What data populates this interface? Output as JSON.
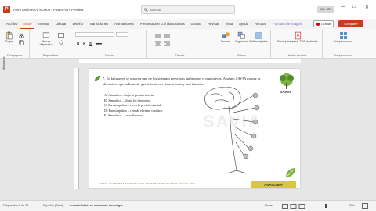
{
  "titlebar": {
    "app_logo": "P",
    "doc_title": "ANATOMÍA REV SEM09 - PowerPoint Preview",
    "search_placeholder": "Buscar",
    "account": "INC. SRL",
    "controls": [
      "—",
      "□",
      "✕"
    ]
  },
  "tabs": [
    {
      "label": "Archivo"
    },
    {
      "label": "Inicio",
      "active": true
    },
    {
      "label": "Insertar"
    },
    {
      "label": "Dibujar"
    },
    {
      "label": "Diseño"
    },
    {
      "label": "Transiciones"
    },
    {
      "label": "Animaciones"
    },
    {
      "label": "Presentación con diapositivas"
    },
    {
      "label": "Grabar"
    },
    {
      "label": "Revisar"
    },
    {
      "label": "Vista"
    },
    {
      "label": "Ayuda"
    },
    {
      "label": "Acrobat"
    },
    {
      "label": "Formato de imagen",
      "context": true
    }
  ],
  "actions": {
    "record": "Grabar",
    "share": "Compartir"
  },
  "ribbon": {
    "groups": [
      "Portapapeles",
      "Diapositivas",
      "Fuente",
      "Párrafo",
      "Dibujo",
      "Adobe Acrobat",
      "Complementos"
    ],
    "buttons": {
      "paste": "Pegar",
      "new_slide": "Nueva diapositiva",
      "shapes": "Formas",
      "arrange": "Organizar",
      "quick_styles": "Estilos rápidos",
      "create_pdf": "Crear y compartir PDF de Adobe",
      "addins": "Complementos"
    },
    "font_format": [
      "N",
      "K",
      "S",
      "abc"
    ]
  },
  "side": {
    "label": "Miniaturas"
  },
  "slide": {
    "question": "7. En la imagen se observa uno de los sistemas nerviosos autónomos o vegetativos. Alumno SAVIA escoge la alternativa que indique de qué sistema nervioso se trata y una función.",
    "options": [
      "A) Simpático – baja la presión arterial",
      "B) Simpático – dilata los bronquios",
      "C) Parasimpático – eleva la presión arterial",
      "D) Parasimpático – retarda el ritmo cardíaco",
      "E) Simpático – vasodilatador"
    ],
    "watermark": "SAVIA",
    "logo_label": "SAVIA",
    "footer": "SOMOS LA PRIMERA ACADEMIA CON DOCTOR ESPECIALIZADO PARA TI 2023",
    "tag": "ANATOMÍA"
  },
  "status": {
    "slide_info": "Diapositiva 8 de 32",
    "language": "Español (Perú)",
    "accessibility": "Accesibilidad: es necesario investigar",
    "notes": "Notas",
    "zoom": "60%"
  },
  "colors": {
    "accent": "#c43e1c",
    "context": "#7a5cc7",
    "tag": "#d9c83e"
  }
}
